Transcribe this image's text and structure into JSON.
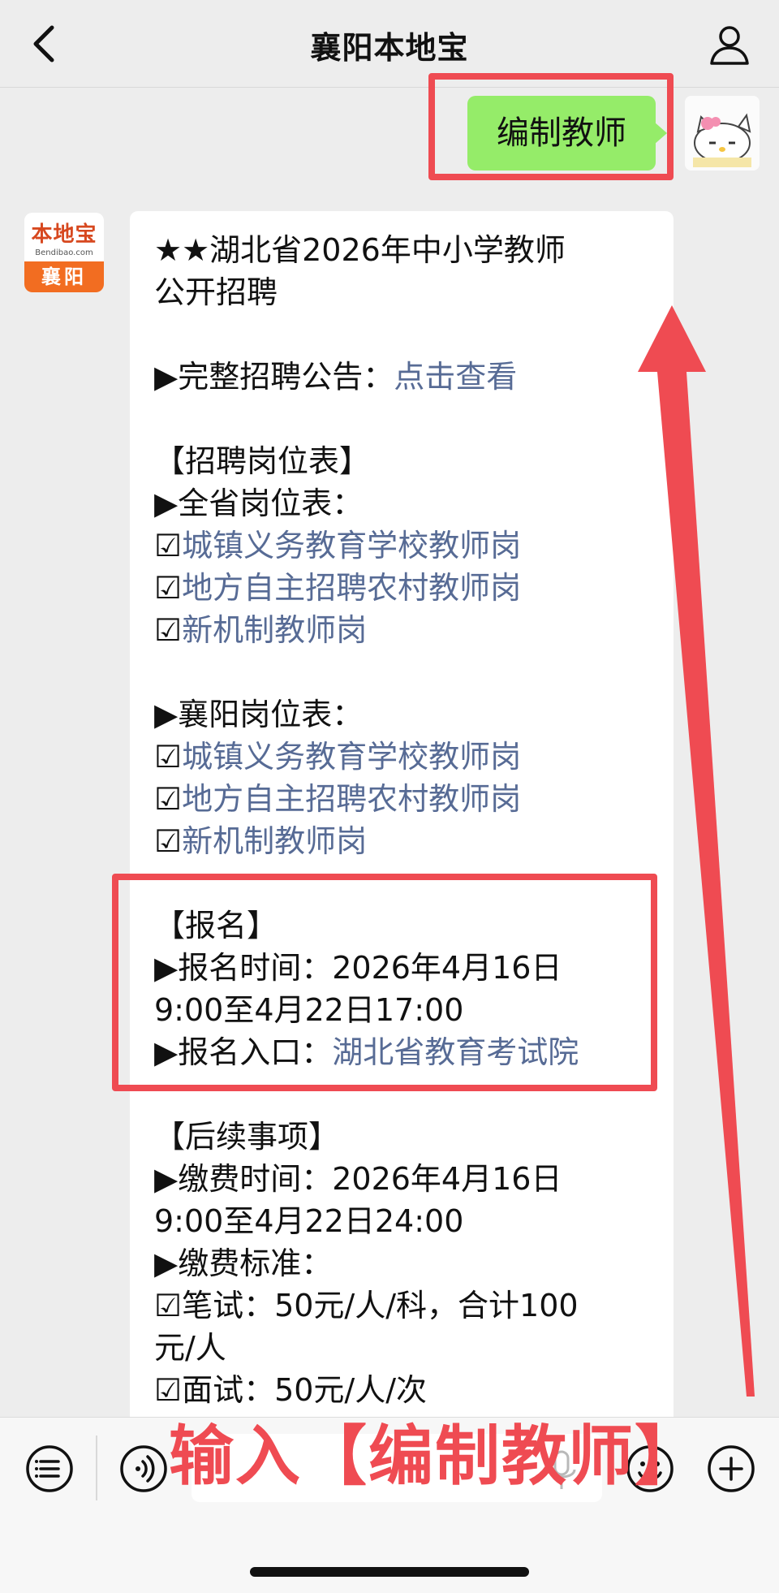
{
  "header": {
    "title": "襄阳本地宝",
    "back_icon": "chevron-left-icon",
    "user_icon": "user-icon"
  },
  "sent_message": {
    "text": "编制教师"
  },
  "bot_avatar": {
    "brand": "本地宝",
    "sub": "Bendibao.com",
    "city": "襄阳"
  },
  "reply": {
    "title_line1": "★★湖北省2026年中小学教师",
    "title_line2": "公开招聘",
    "notice_prefix": "▶完整招聘公告：",
    "notice_link": "点击查看",
    "positions_header": "【招聘岗位表】",
    "province_label": "▶全省岗位表：",
    "province_items": [
      "城镇义务教育学校教师岗",
      "地方自主招聘农村教师岗",
      "新机制教师岗"
    ],
    "xiangyang_label": "▶襄阳岗位表：",
    "xiangyang_items": [
      "城镇义务教育学校教师岗",
      "地方自主招聘农村教师岗",
      "新机制教师岗"
    ],
    "checkbox_glyph": "☑",
    "reg_header": "【报名】",
    "reg_time_line1": "▶报名时间：2026年4月16日",
    "reg_time_line2": "9:00至4月22日17:00",
    "reg_entry_prefix": "▶报名入口：",
    "reg_entry_link": "湖北省教育考试院",
    "follow_header": "【后续事项】",
    "fee_time_line1": "▶缴费时间：2026年4月16日",
    "fee_time_line2": "9:00至4月22日24:00",
    "fee_std_label": "▶缴费标准：",
    "fee_written_line1": "☑笔试：50元/人/科，合计100",
    "fee_written_line2": "元/人",
    "fee_interview": "☑面试：50元/人/次"
  },
  "annotation": {
    "overlay_text": "输入【编制教师】",
    "accent_color": "#ef4b52"
  },
  "input_bar": {
    "menu_icon": "menu-list-icon",
    "voice_icon": "voice-icon",
    "mic_icon": "mic-icon",
    "emoji_icon": "emoji-icon",
    "plus_icon": "plus-icon"
  },
  "colors": {
    "background": "#ededed",
    "sent_bubble": "#95ec69",
    "link": "#576b95",
    "brand_orange": "#f26d21"
  }
}
